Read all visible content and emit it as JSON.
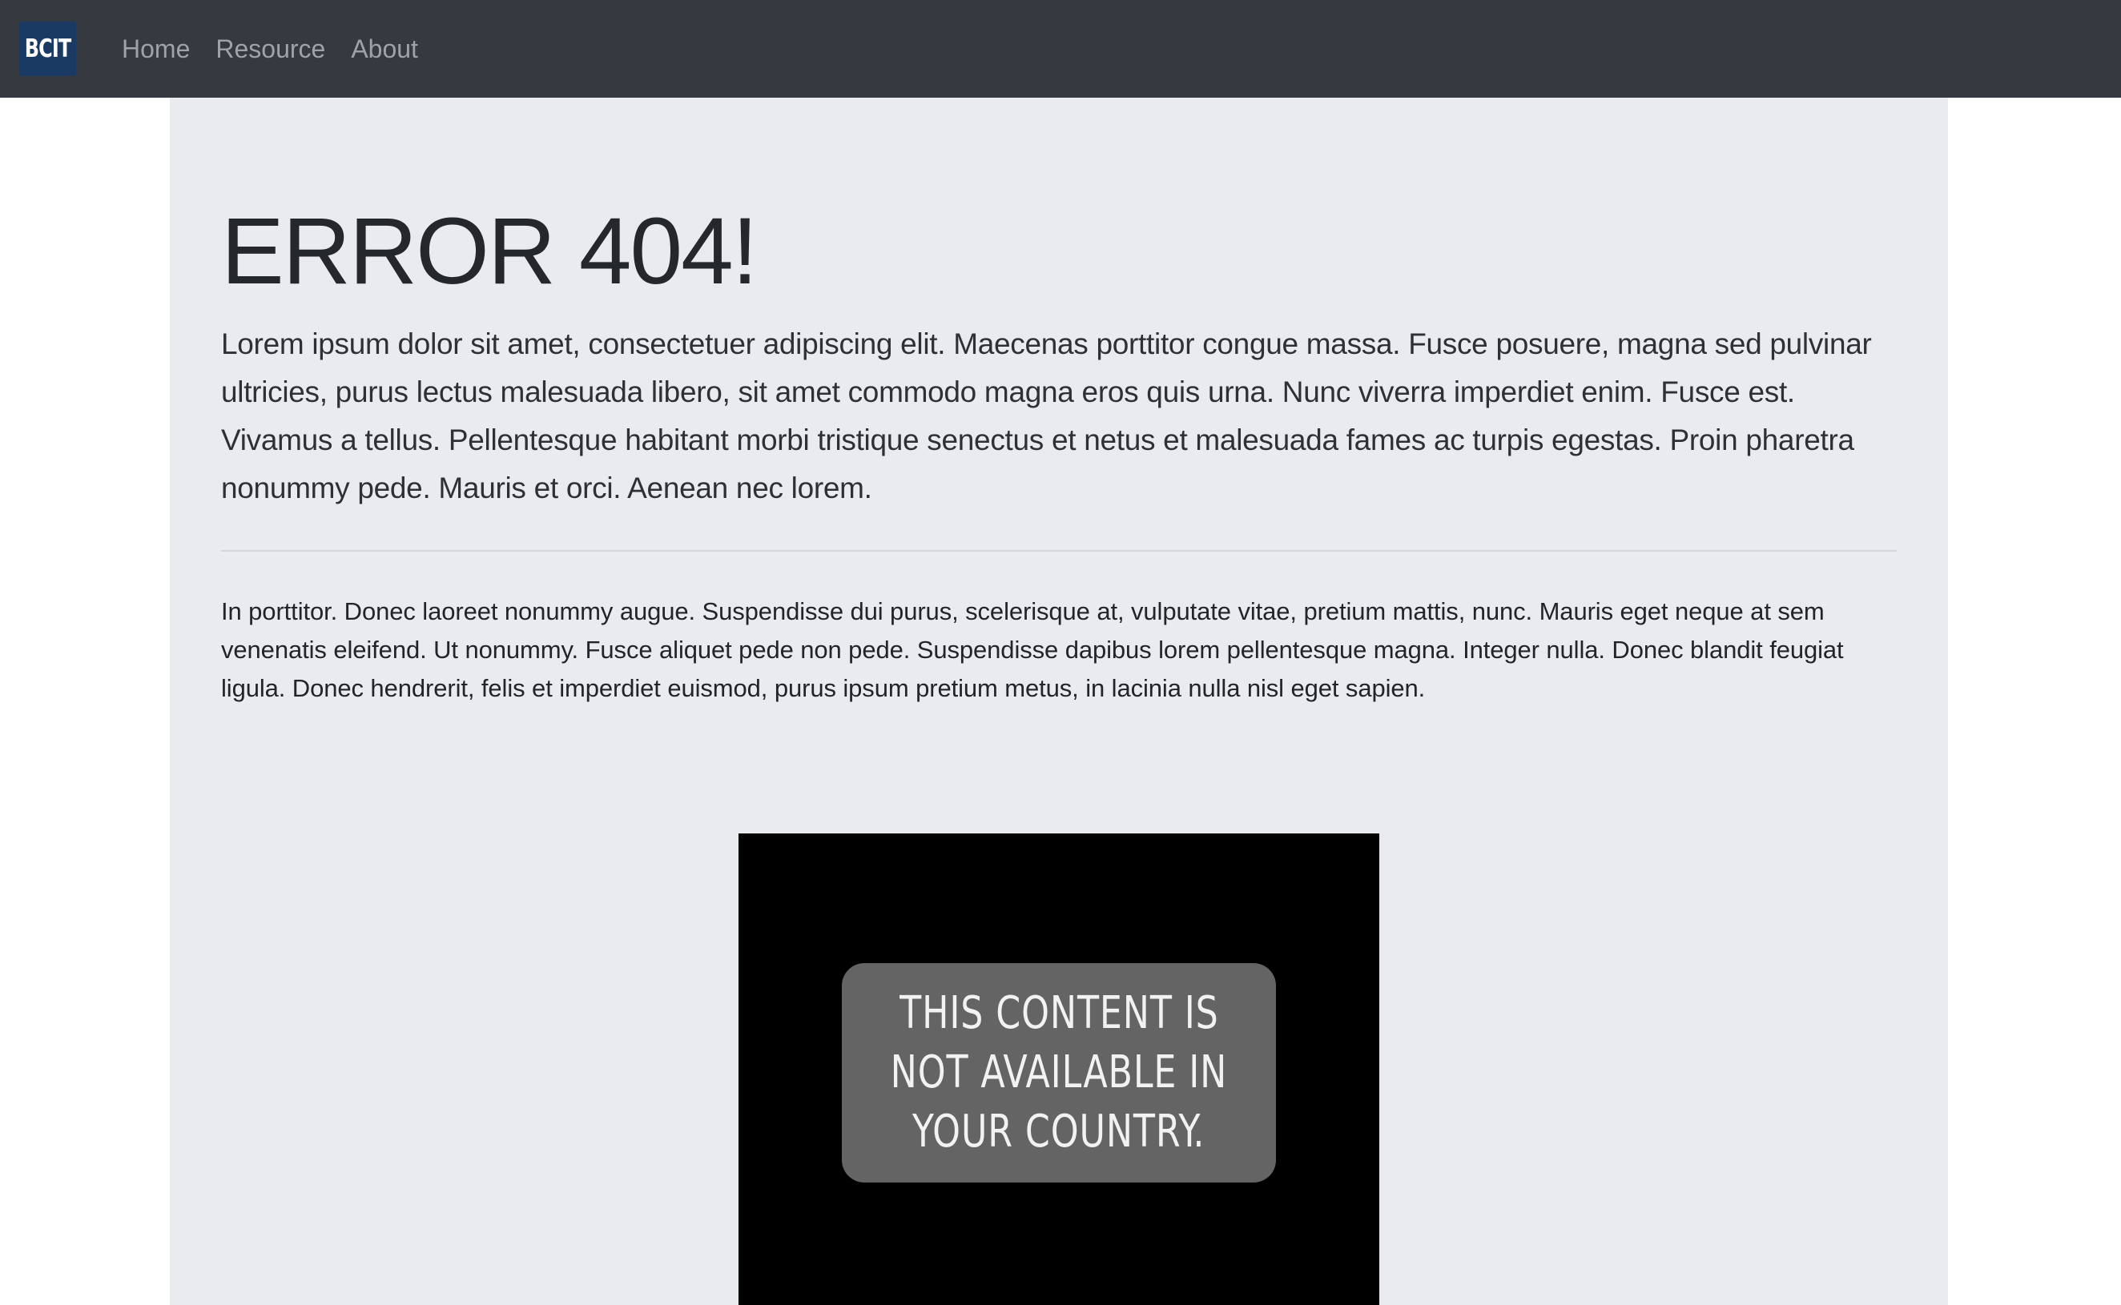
{
  "navbar": {
    "brand": "BCIT",
    "links": [
      "Home",
      "Resource",
      "About"
    ]
  },
  "main": {
    "title": "ERROR 404!",
    "lead": "Lorem ipsum dolor sit amet, consectetuer adipiscing elit. Maecenas porttitor congue massa. Fusce posuere, magna sed pulvinar ultricies, purus lectus malesuada libero, sit amet commodo magna eros quis urna. Nunc viverra imperdiet enim. Fusce est. Vivamus a tellus. Pellentesque habitant morbi tristique senectus et netus et malesuada fames ac turpis egestas. Proin pharetra nonummy pede. Mauris et orci. Aenean nec lorem.",
    "body": "In porttitor. Donec laoreet nonummy augue. Suspendisse dui purus, scelerisque at, vulputate vitae, pretium mattis, nunc. Mauris eget neque at sem venenatis eleifend. Ut nonummy. Fusce aliquet pede non pede. Suspendisse dapibus lorem pellentesque magna. Integer nulla. Donec blandit feugiat ligula. Donec hendrerit, felis et imperdiet euismod, purus ipsum pretium metus, in lacinia nulla nisl eget sapien.",
    "comic_lines": [
      "THIS CONTENT IS",
      "NOT AVAILABLE IN",
      "YOUR COUNTRY."
    ]
  },
  "colors": {
    "navbar_bg": "#343a40",
    "brand_bg": "#1a3a63",
    "jumbotron_bg": "#e9ebef",
    "comic_bg": "#000000",
    "comic_box": "#646464"
  }
}
